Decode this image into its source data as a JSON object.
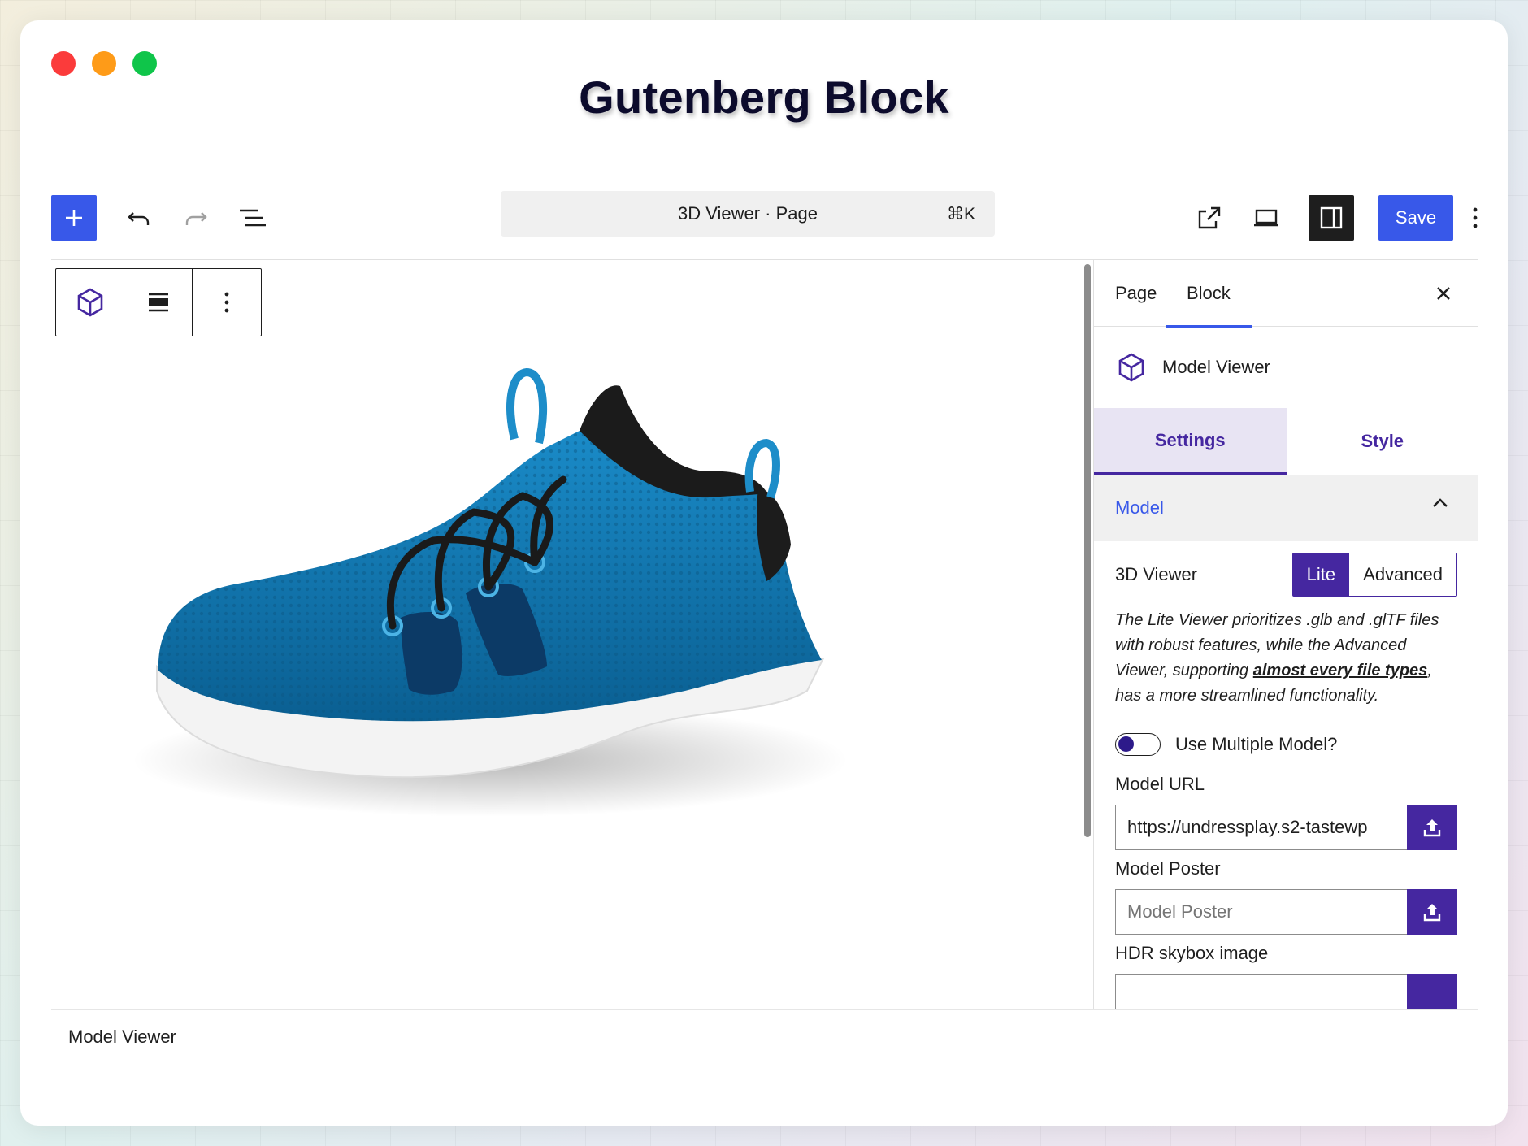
{
  "window": {
    "title": "Gutenberg Block"
  },
  "toolbar": {
    "add_icon": "plus-icon",
    "undo_icon": "undo-icon",
    "redo_icon": "redo-icon",
    "list_view_icon": "list-view-icon",
    "command_label": "3D Viewer · Page",
    "command_shortcut": "⌘K",
    "view_icon": "external-link-icon",
    "preview_icon": "desktop-preview-icon",
    "settings_icon": "sidebar-toggle-icon",
    "save_label": "Save",
    "options_icon": "more-vertical-icon"
  },
  "block_toolbar": {
    "block_icon": "cube-icon",
    "align_icon": "align-icon",
    "more_icon": "more-vertical-icon"
  },
  "canvas": {
    "image": "blue-sneaker-3d-model"
  },
  "breadcrumb": {
    "label": "Model Viewer"
  },
  "sidebar": {
    "tabs": [
      {
        "label": "Page"
      },
      {
        "label": "Block",
        "active": true
      }
    ],
    "close_icon": "close-icon",
    "block_name": "Model Viewer",
    "block_icon": "cube-icon",
    "subtabs": [
      {
        "label": "Settings",
        "active": true
      },
      {
        "label": "Style"
      }
    ],
    "panel": {
      "title": "Model",
      "expanded": true,
      "viewer_label": "3D Viewer",
      "viewer_options": [
        "Lite",
        "Advanced"
      ],
      "viewer_selected": "Lite",
      "desc_part1": "The Lite Viewer prioritizes .glb and .glTF files with robust features, while the Advanced Viewer, supporting ",
      "desc_link": "almost every file types",
      "desc_part2": ", has a more streamlined functionality.",
      "multiple_model_label": "Use Multiple Model?",
      "multiple_model_on": false,
      "model_url_label": "Model URL",
      "model_url_value": "https://undressplay.s2-tastewp",
      "model_poster_label": "Model Poster",
      "model_poster_placeholder": "Model Poster",
      "hdr_label": "HDR skybox image",
      "upload_icon": "upload-icon"
    }
  },
  "colors": {
    "wp_blue": "#3858e9",
    "accent_purple": "#4527a0",
    "dark": "#1e1e1e"
  }
}
